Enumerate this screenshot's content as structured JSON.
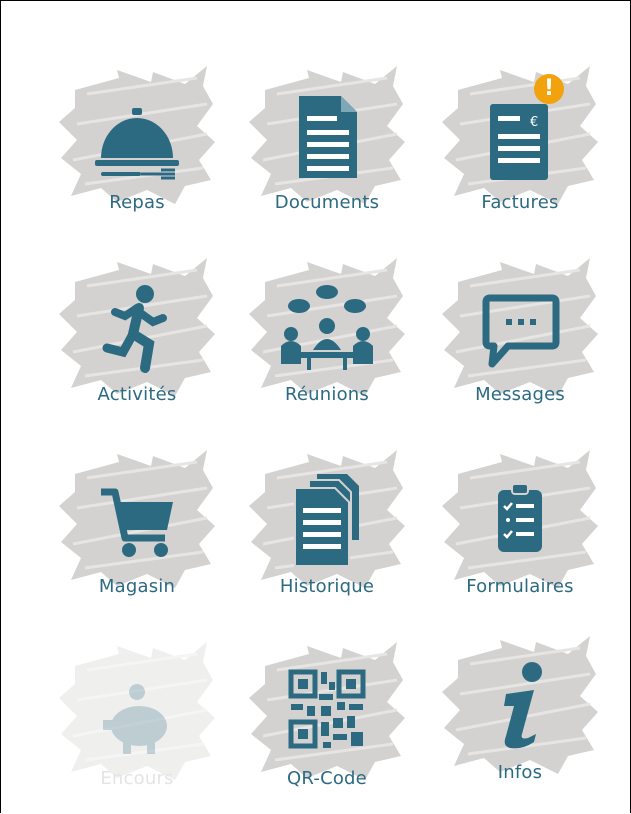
{
  "colors": {
    "accent": "#2c6a82",
    "brush": "#d3d2d0",
    "badge": "#f2a20c",
    "label": "#2c6a82",
    "disabled_label": "#e4e4e4"
  },
  "tiles": [
    {
      "label": "Repas",
      "icon": "serving-cloche-icon",
      "enabled": true
    },
    {
      "label": "Documents",
      "icon": "document-icon",
      "enabled": true
    },
    {
      "label": "Factures",
      "icon": "invoice-icon",
      "enabled": true,
      "badge": "!"
    },
    {
      "label": "Activités",
      "icon": "running-person-icon",
      "enabled": true
    },
    {
      "label": "Réunions",
      "icon": "meeting-icon",
      "enabled": true
    },
    {
      "label": "Messages",
      "icon": "chat-bubble-icon",
      "enabled": true
    },
    {
      "label": "Magasin",
      "icon": "shopping-cart-icon",
      "enabled": true
    },
    {
      "label": "Historique",
      "icon": "history-documents-icon",
      "enabled": true
    },
    {
      "label": "Formulaires",
      "icon": "clipboard-checklist-icon",
      "enabled": true
    },
    {
      "label": "Encours",
      "icon": "piggy-bank-icon",
      "enabled": false
    },
    {
      "label": "QR-Code",
      "icon": "qr-code-icon",
      "enabled": true
    },
    {
      "label": "Infos",
      "icon": "info-icon",
      "enabled": true
    }
  ]
}
